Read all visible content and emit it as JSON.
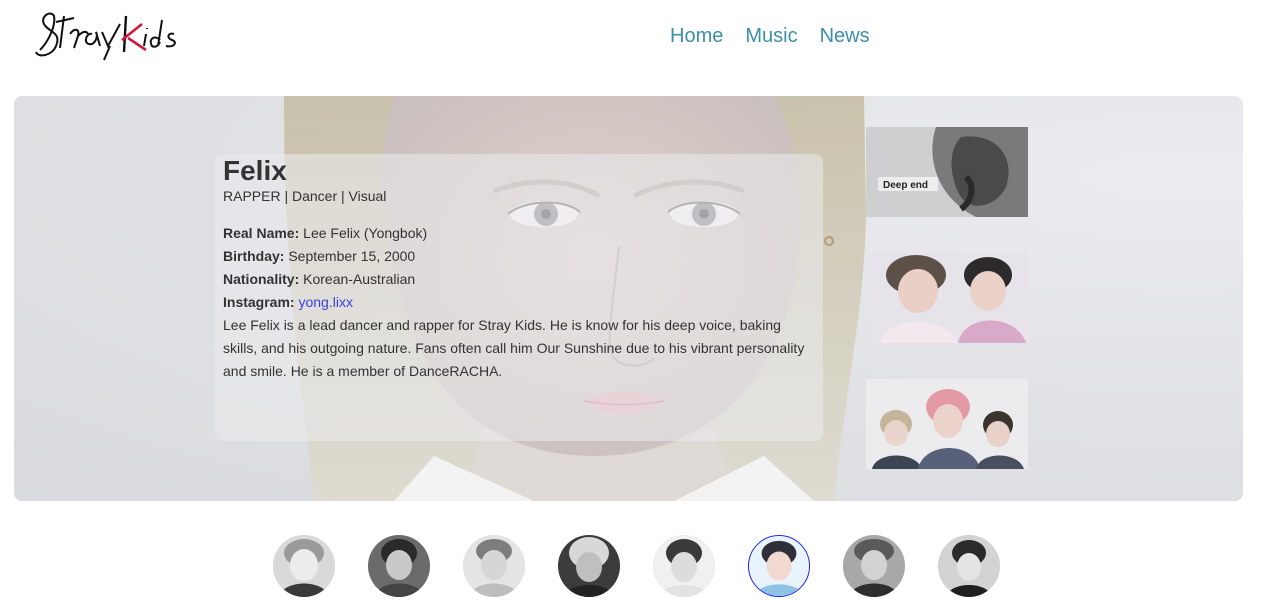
{
  "brand": {
    "logo_text": "Stray Kids"
  },
  "nav": {
    "items": [
      "Home",
      "Music",
      "News"
    ]
  },
  "profile": {
    "name": "Felix",
    "roles": "RAPPER | Dancer | Visual",
    "facts": {
      "real_name_label": "Real Name:",
      "real_name": "Lee Felix (Yongbok)",
      "birthday_label": "Birthday:",
      "birthday": "September 15, 2000",
      "nationality_label": "Nationality:",
      "nationality": "Korean-Australian",
      "instagram_label": "Instagram:",
      "instagram": "yong.lixx"
    },
    "bio": "Lee Felix is a lead dancer and rapper for Stray Kids. He is know for his deep voice, baking skills, and his outgoing nature. Fans often call him Our Sunshine due to his vibrant personality and smile. He is a member of DanceRACHA."
  },
  "gallery": {
    "cover_text": "Deep end"
  },
  "members": {
    "count": 8,
    "active_index": 5
  },
  "colors": {
    "nav_link": "#3b8fa9",
    "instagram_link": "#3b40e0",
    "active_ring": "#1a1aff",
    "logo_accent": "#d0183a"
  }
}
